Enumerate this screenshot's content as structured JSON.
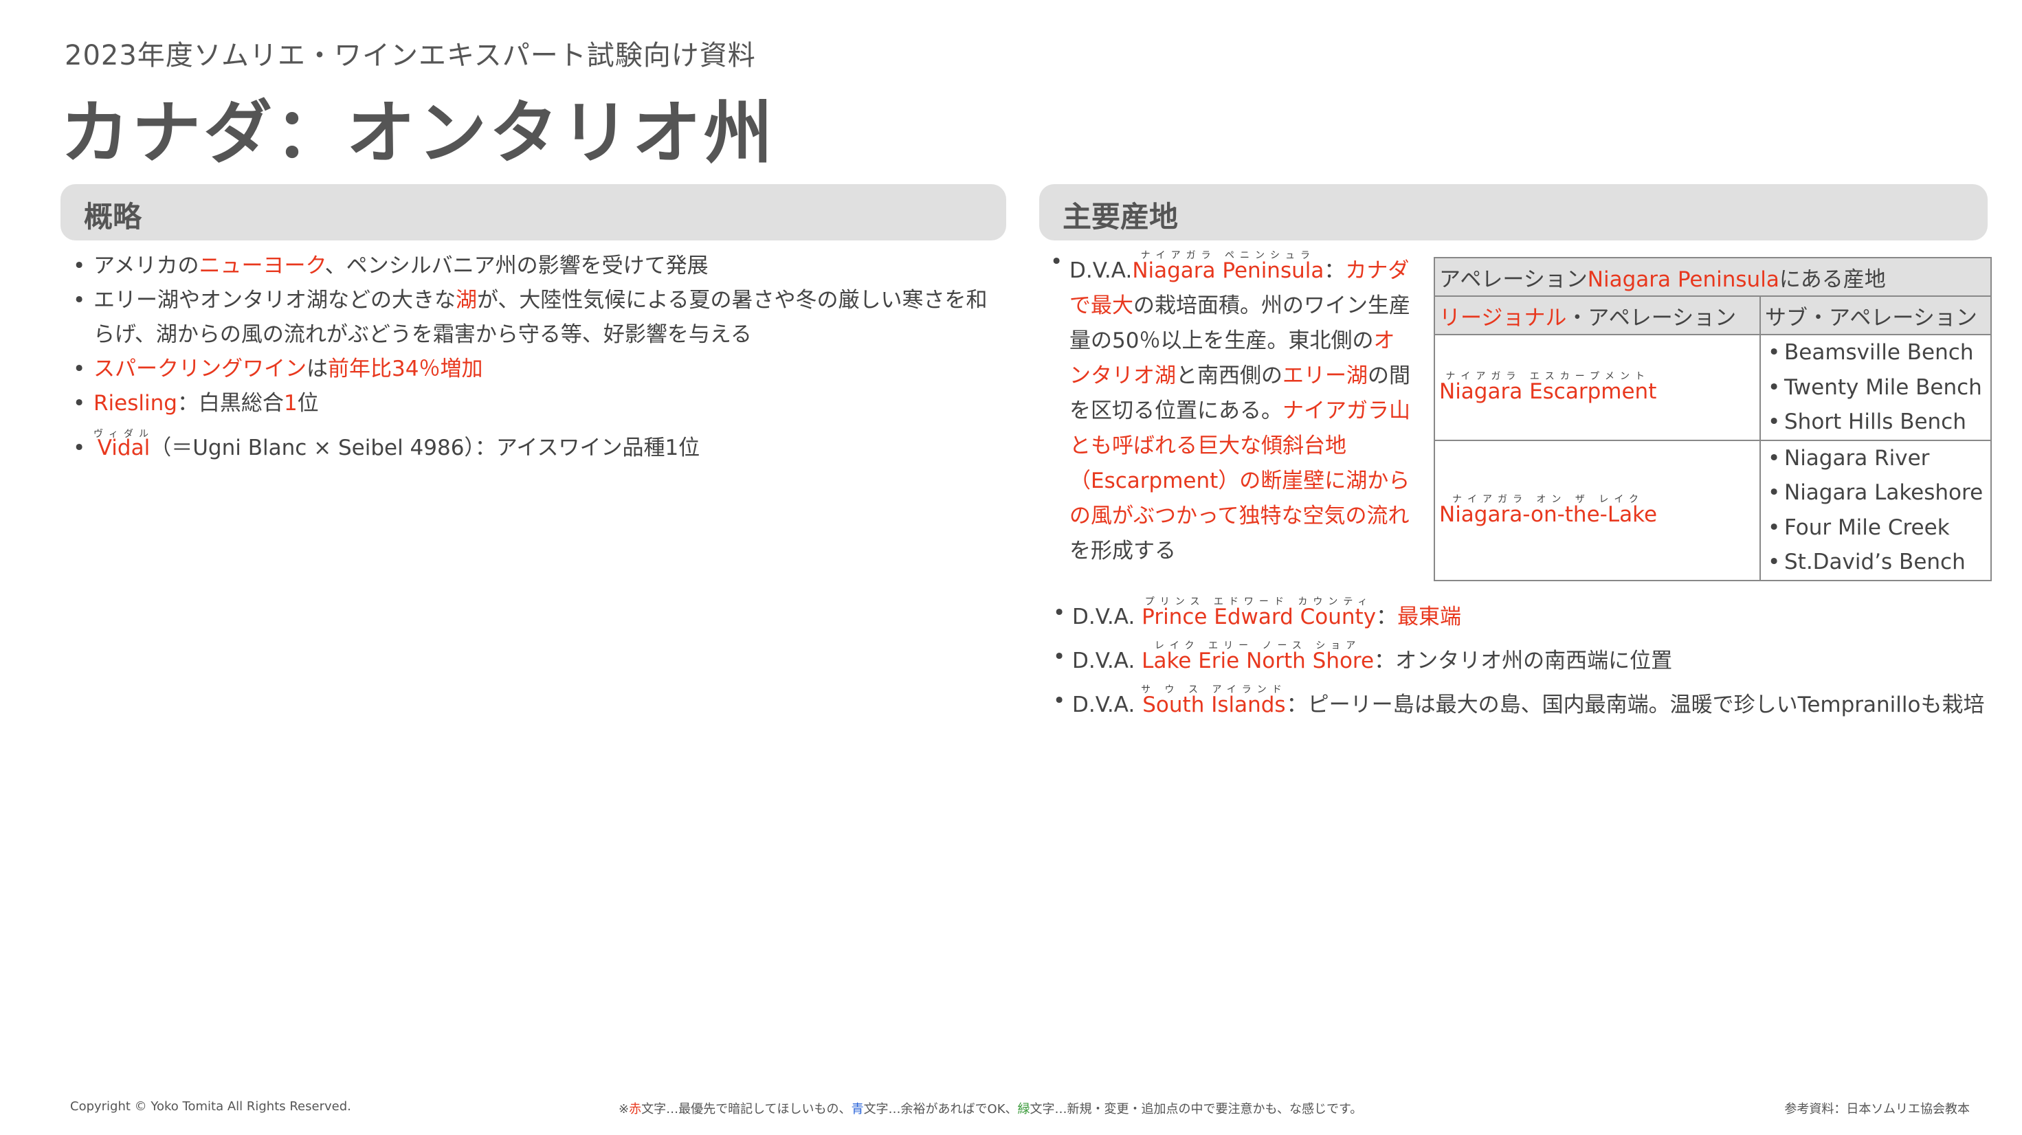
{
  "header": {
    "subtitle": "2023年度ソムリエ・ワインエキスパート試験向け資料",
    "title": "カナダ：オンタリオ州"
  },
  "sections": {
    "overview": "概略",
    "regions": "主要産地"
  },
  "overview": {
    "item1": {
      "a": "アメリカの",
      "b": "ニューヨーク",
      "c": "、ペンシルバニア州の影響を受けて発展"
    },
    "item2": {
      "a": "エリー湖やオンタリオ湖などの大きな",
      "b": "湖",
      "c": "が、大陸性気候による夏の暑さや冬の厳しい寒さを和らげ、湖からの風の流れがぶどうを霜害から守る等、好影響を与える"
    },
    "item3": {
      "a": "スパークリングワイン",
      "b": "は",
      "c": "前年比34％増加"
    },
    "item4": {
      "a": "Riesling",
      "b": "：白黒総合",
      "c": "1",
      "d": "位"
    },
    "item5": {
      "a": "Vidal",
      "ruby": "ヴィダル",
      "b": "（＝Ugni Blanc × Seibel 4986）：アイスワイン品種1位"
    }
  },
  "peninsula": {
    "prefix": "D.V.A.",
    "name": "Niagara Peninsula",
    "ruby": "ナイアガラ ペニンシュラ",
    "colon": "：",
    "r1": "カナダで最大",
    "t1": "の栽培面積。州のワイン生産量の50％以上を生産。東北側の",
    "r2": "オンタリオ湖",
    "t2": "と南西側の",
    "r3": "エリー湖",
    "t3": "の間を区切る位置にある。",
    "r4": "ナイアガラ山とも呼ばれる巨大な傾斜台地（Escarpment）の断崖壁に湖からの風がぶつかって独特な空気の流れ",
    "t4": "を形成する"
  },
  "table": {
    "head_a": "アペレーション",
    "head_b": "Niagara Peninsula",
    "head_c": "にある産地",
    "col1_a": "リージョナル",
    "col1_b": "・アペレーション",
    "col2": "サブ・アペレーション",
    "rows": [
      {
        "ruby": "ナイアガラ エスカープメント",
        "name": "Niagara Escarpment",
        "subs": [
          "Beamsville Bench",
          "Twenty Mile Bench",
          "Short Hills Bench"
        ]
      },
      {
        "ruby": "ナイアガラ オン ザ レイク",
        "name": "Niagara-on-the-Lake",
        "subs": [
          "Niagara River",
          "Niagara Lakeshore",
          "Four Mile Creek",
          "St.David’s Bench"
        ]
      }
    ]
  },
  "dva": [
    {
      "prefix": "D.V.A. ",
      "name": "Prince Edward County",
      "ruby": "プリンス エドワード カウンティ",
      "sep": "：",
      "note_red": "最東端",
      "note": ""
    },
    {
      "prefix": "D.V.A. ",
      "name": "Lake Erie North Shore",
      "ruby": "レイク エリー ノース ショア",
      "sep": "：",
      "note_red": "",
      "note": "オンタリオ州の南西端に位置"
    },
    {
      "prefix": "D.V.A. ",
      "name": "South Islands",
      "ruby": "サ ウ ス アイランド",
      "sep": "：",
      "note_red": "",
      "note": "ピーリー島は最大の島、国内最南端。温暖で珍しいTempranilloも栽培"
    }
  ],
  "footer": {
    "copyright": "Copyright © Yoko Tomita All Rights Reserved.",
    "legend": {
      "mark": "※",
      "red": "赤",
      "red_desc": "文字…最優先で暗記してほしいもの、",
      "blue": "青",
      "blue_desc": "文字…余裕があればでOK、",
      "green": "緑",
      "green_desc": "文字…新規・変更・追加点の中で要注意かも、な感じです。"
    },
    "reference": "参考資料：日本ソムリエ協会教本"
  },
  "colors": {
    "accent_red": "#e8381e",
    "bar_gray": "#e0e0e0",
    "text": "#444444"
  }
}
